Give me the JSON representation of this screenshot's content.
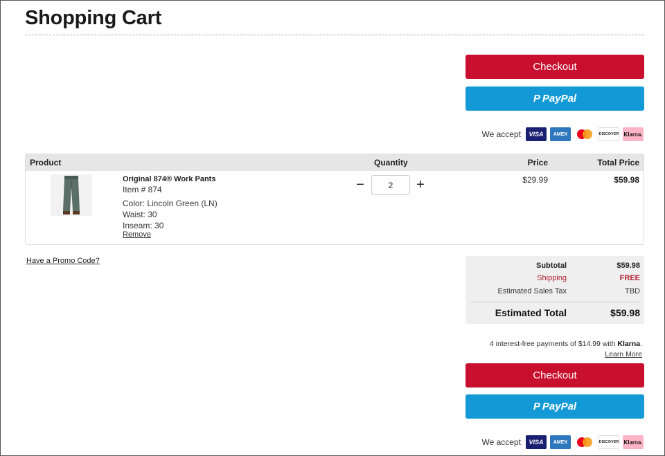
{
  "page": {
    "title": "Shopping Cart"
  },
  "actions": {
    "checkout_label": "Checkout",
    "paypal_label": "PayPal",
    "paypal_glyph": "P"
  },
  "accept": {
    "label": "We accept",
    "cards": [
      {
        "name": "visa-icon",
        "text": "VISA"
      },
      {
        "name": "amex-icon",
        "text": "AMEX"
      },
      {
        "name": "mastercard-icon",
        "text": ""
      },
      {
        "name": "discover-icon",
        "text": "DISCOVER"
      },
      {
        "name": "klarna-icon",
        "text": "Klarna."
      }
    ]
  },
  "table": {
    "headers": {
      "product": "Product",
      "quantity": "Quantity",
      "price": "Price",
      "total": "Total Price"
    },
    "item": {
      "name": "Original 874® Work Pants",
      "item_no": "Item # 874",
      "color": "Color: Lincoln Green (LN)",
      "waist": "Waist: 30",
      "inseam": "Inseam: 30",
      "remove": "Remove",
      "quantity": "2",
      "minus": "−",
      "plus": "+",
      "unit_price": "$29.99",
      "total_price": "$59.98"
    }
  },
  "promo": {
    "label": "Have a Promo Code?"
  },
  "summary": {
    "subtotal_label": "Subtotal",
    "subtotal_value": "$59.98",
    "shipping_label": "Shipping",
    "shipping_value": "FREE",
    "tax_label": "Estimated Sales Tax",
    "tax_value": "TBD",
    "total_label": "Estimated Total",
    "total_value": "$59.98"
  },
  "klarna": {
    "text": "4 interest-free payments of $14.99 with",
    "brand": "Klarna",
    "period": ".",
    "learn_more": "Learn More"
  },
  "colors": {
    "checkout": "#c8102e",
    "paypal": "#139ad6",
    "shipping": "#b01c2e",
    "summary_bg": "#efefef"
  }
}
